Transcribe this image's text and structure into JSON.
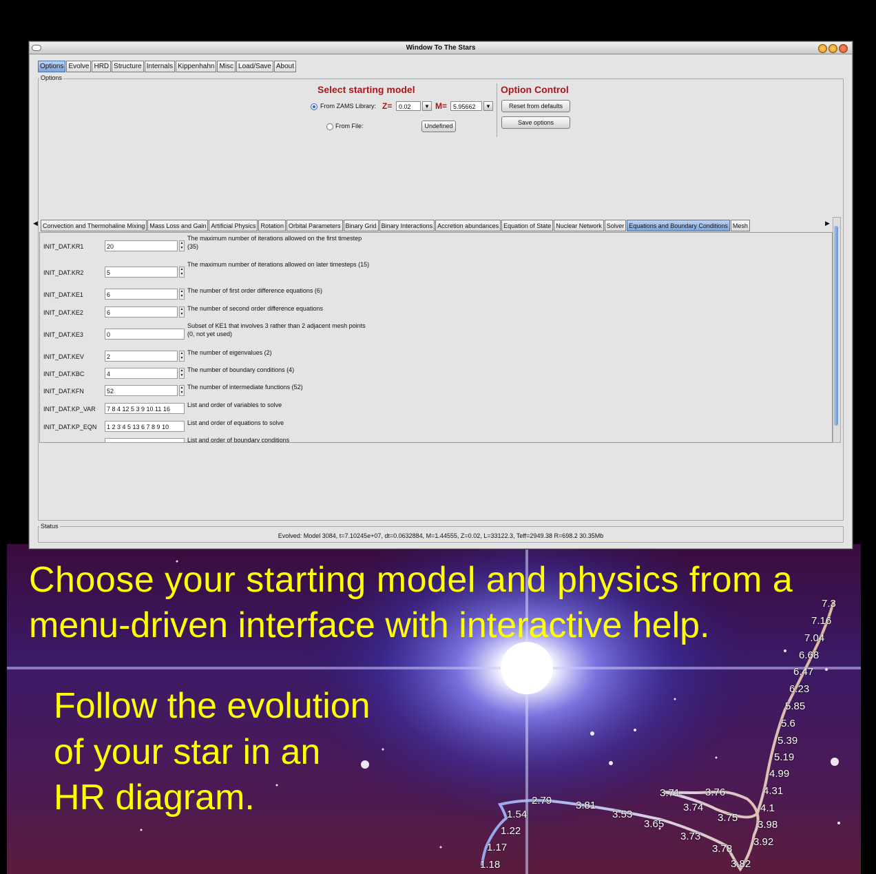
{
  "window": {
    "title": "Window To The Stars"
  },
  "main_tabs": [
    "Options",
    "Evolve",
    "HRD",
    "Structure",
    "Internals",
    "Kippenhahn",
    "Misc",
    "Load/Save",
    "About"
  ],
  "options_group": {
    "title": "Options"
  },
  "starting_model": {
    "header": "Select starting model",
    "zams_label": "From ZAMS Library:",
    "z_label": "Z=",
    "z_value": "0.02",
    "m_label": "M=",
    "m_value": "5.95662",
    "file_label": "From File:",
    "file_button": "Undefined"
  },
  "option_control": {
    "header": "Option Control",
    "reset_button": "Reset from defaults",
    "save_button": "Save options"
  },
  "sub_tabs": [
    "Convection and Thermohaline Mixing",
    "Mass Loss and Gain",
    "Artificial Physics",
    "Rotation",
    "Orbital Parameters",
    "Binary Grid",
    "Binary Interactions",
    "Accretion abundances",
    "Equation of State",
    "Nuclear Network",
    "Solver",
    "Equations and Boundary Conditions",
    "Mesh"
  ],
  "selected_sub_tab": "Equations and Boundary Conditions",
  "params": [
    {
      "name": "INIT_DAT.KR1",
      "value": "20",
      "desc": "The maximum number of iterations allowed on the first timestep\n(35)"
    },
    {
      "name": "INIT_DAT.KR2",
      "value": "5",
      "desc": "The maximum number of iterations allowed on later timesteps (15)"
    },
    {
      "name": "INIT_DAT.KE1",
      "value": "6",
      "desc": "The number of first order difference equations (6)"
    },
    {
      "name": "INIT_DAT.KE2",
      "value": "6",
      "desc": "The number of second order difference equations"
    },
    {
      "name": "INIT_DAT.KE3",
      "value": "0",
      "desc": "Subset of KE1 that involves 3 rather than 2 adjacent mesh points\n(0, not yet used)"
    },
    {
      "name": "INIT_DAT.KEV",
      "value": "2",
      "desc": "The number of eigenvalues (2)"
    },
    {
      "name": "INIT_DAT.KBC",
      "value": "4",
      "desc": "The number of boundary conditions (4)"
    },
    {
      "name": "INIT_DAT.KFN",
      "value": "52",
      "desc": "The number of intermediate functions (52)"
    },
    {
      "name": "INIT_DAT.KP_VAR",
      "value": "7 8 4 12 5 3 9 10 11 16",
      "desc": "List and order of variables to solve"
    },
    {
      "name": "INIT_DAT.KP_EQN",
      "value": "1 2 3 4 5 13 6 7 8 9 10",
      "desc": "List and order of equations to solve"
    },
    {
      "name": "",
      "value": "",
      "desc": "List and order of boundary conditions"
    }
  ],
  "status": {
    "title": "Status",
    "text": "Evolved: Model 3084, t=7.10245e+07, dt=0.0632884, M=1.44555, Z=0.02, L=33122.3, Teff=2949.38 R=698.2 30.35Mb"
  },
  "captions": {
    "line1": "Choose your starting model and physics from a",
    "line2": "menu-driven interface with interactive help.",
    "follow": [
      "Follow the evolution",
      "of your star in an",
      "HR diagram."
    ]
  },
  "hr_labels": [
    "7.3",
    "7.16",
    "7.04",
    "6.68",
    "6.47",
    "6.23",
    "5.85",
    "5.6",
    "5.39",
    "5.19",
    "4.99",
    "4.31",
    "4.1",
    "3.98",
    "3.92",
    "3.82",
    "3.78",
    "3.73",
    "3.75",
    "3.74",
    "3.76",
    "3.71",
    "3.65",
    "3.53",
    "3.81",
    "2.79",
    "1.54",
    "1.22",
    "1.17",
    "1.18"
  ],
  "colors": {
    "caption": "#ffff00",
    "header_red": "#a8181b",
    "selected_tab": "#7fa4dc"
  }
}
